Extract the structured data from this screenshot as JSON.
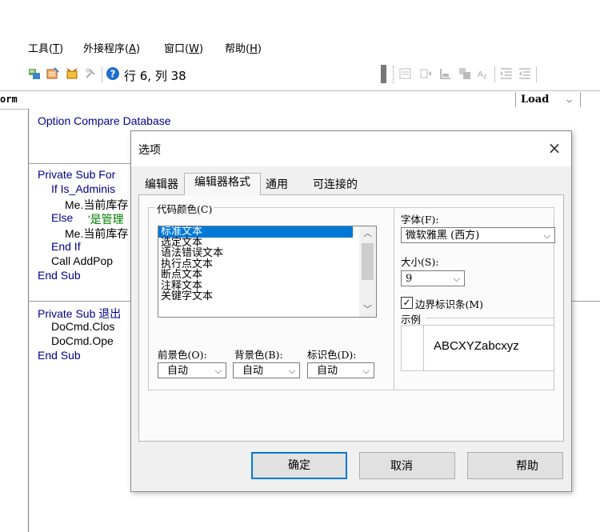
{
  "menubar": {
    "items": [
      {
        "label": "工具(",
        "key": "T",
        "tail": ")"
      },
      {
        "label": "外接程序(",
        "key": "A",
        "tail": ")"
      },
      {
        "label": "窗口(",
        "key": "W",
        "tail": ")"
      },
      {
        "label": "帮助(",
        "key": "H",
        "tail": ")"
      }
    ]
  },
  "toolbar": {
    "position": "行 6, 列 38"
  },
  "code_header": {
    "object_combo": "orm",
    "proc_combo": "Load"
  },
  "code": {
    "lines": [
      "Option Compare Database",
      "Private Sub For",
      "If Is_Adminis",
      "Me.当前库存",
      "Else",
      "'是管理",
      "Me.当前库存",
      "End If",
      "Call AddPop",
      "End Sub",
      "Private Sub 退出",
      "DoCmd.Clos",
      "DoCmd.Ope",
      "End Sub"
    ]
  },
  "dialog": {
    "title": "选项",
    "close": "×",
    "tabs": [
      "编辑器",
      "编辑器格式",
      "通用",
      "可连接的"
    ],
    "code_colors": {
      "label": "代码颜色(C)",
      "items": [
        "标准文本",
        "选定文本",
        "语法错误文本",
        "执行点文本",
        "断点文本",
        "注释文本",
        "关键字文本"
      ],
      "selected_index": 0
    },
    "foreground": {
      "label": "前景色(O):",
      "value": "自动"
    },
    "background": {
      "label": "背景色(B):",
      "value": "自动"
    },
    "indicator": {
      "label": "标识色(D):",
      "value": "自动"
    },
    "font": {
      "label": "字体(F):",
      "value": "微软雅黑 (西方)"
    },
    "size": {
      "label": "大小(S):",
      "value": "9"
    },
    "margin_bar": {
      "label": "边界标识条(M)",
      "checked": true
    },
    "sample": {
      "label": "示例",
      "text": "ABCXYZabcxyz"
    },
    "buttons": {
      "ok": "确定",
      "cancel": "取消",
      "help": "帮助"
    }
  },
  "colors": {
    "accent": "#0078d7",
    "code_keyword": "#00008b",
    "code_comment": "#008000"
  }
}
